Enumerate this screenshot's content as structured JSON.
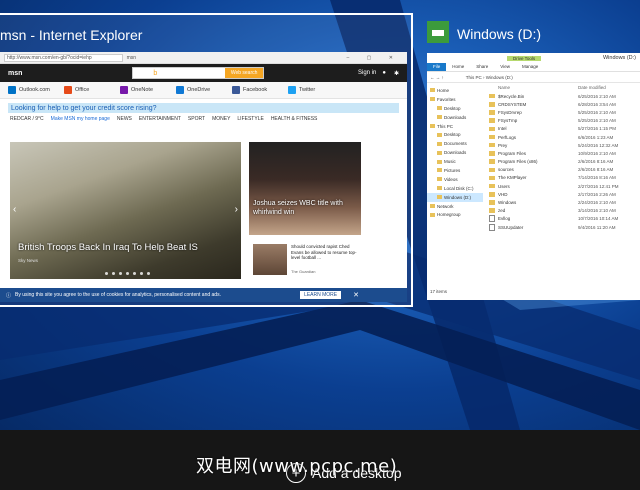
{
  "ie_window": {
    "title": "msn - Internet Explorer",
    "address_url": "http://www.msn.com/en-gb/?ocid=iehp",
    "address_tab": "msn",
    "msn": {
      "logo": "msn",
      "search_button": "Web search",
      "sign_in": "Sign in",
      "apps": [
        "Outlook.com",
        "Office",
        "OneNote",
        "OneDrive",
        "Facebook",
        "Twitter"
      ],
      "ad_text": "Looking for help to get your credit score rising?",
      "location": "REDCAR / 9°C",
      "make_home": "Make MSN my home page",
      "nav": [
        "NEWS",
        "ENTERTAINMENT",
        "SPORT",
        "MONEY",
        "LIFESTYLE",
        "HEALTH & FITNESS"
      ],
      "hero_caption": "British Troops Back In Iraq To Help Beat IS",
      "hero_source": "Sky News",
      "side_caption": "Joshua seizes WBC title with whirlwind win",
      "story_text": "Should convicted rapist Ched Evans be allowed to resume top-level football ...",
      "story_source": "The Guardian",
      "cookie_text": "By using this site you agree to the use of cookies for analytics, personalised content and ads.",
      "learn_more": "LEARN MORE",
      "close": "✕"
    }
  },
  "explorer_window": {
    "title": "Windows (D:)",
    "titlebar_tab": "Drive Tools",
    "titlebar_title": "Windows (D:)",
    "ribbon_tabs": [
      "File",
      "Home",
      "Share",
      "View",
      "Manage"
    ],
    "address_path": "This PC › Windows (D:)",
    "column_name": "Name",
    "column_date": "Date modified",
    "nav": [
      {
        "label": "Home",
        "selected": false
      },
      {
        "label": "Favorites",
        "selected": false
      },
      {
        "label": "Desktop",
        "selected": false
      },
      {
        "label": "Downloads",
        "selected": false
      },
      {
        "label": "This PC",
        "selected": false
      },
      {
        "label": "Desktop",
        "selected": false
      },
      {
        "label": "Documents",
        "selected": false
      },
      {
        "label": "Downloads",
        "selected": false
      },
      {
        "label": "Music",
        "selected": false
      },
      {
        "label": "Pictures",
        "selected": false
      },
      {
        "label": "Videos",
        "selected": false
      },
      {
        "label": "Local Disk (C:)",
        "selected": false
      },
      {
        "label": "Windows (D:)",
        "selected": true
      },
      {
        "label": "Network",
        "selected": false
      },
      {
        "label": "Homegroup",
        "selected": false
      }
    ],
    "files": [
      {
        "name": "$Recycle.Bin",
        "date": "6/25/2016 2:10 AM",
        "folder": true
      },
      {
        "name": "CRDSYSTEM",
        "date": "6/28/2016 3:54 AM",
        "folder": true
      },
      {
        "name": "FSysDrvrep",
        "date": "5/25/2016 2:10 AM",
        "folder": true
      },
      {
        "name": "FSysTmp",
        "date": "5/25/2016 2:10 AM",
        "folder": true
      },
      {
        "name": "Intel",
        "date": "5/27/2016 1:15 PM",
        "folder": true
      },
      {
        "name": "PerfLogs",
        "date": "6/6/2016 1:23 AM",
        "folder": true
      },
      {
        "name": "Prey",
        "date": "5/24/2016 12:32 AM",
        "folder": true
      },
      {
        "name": "Program Files",
        "date": "10/9/2016 2:10 AM",
        "folder": true
      },
      {
        "name": "Program Files (x86)",
        "date": "2/6/2016 8:16 AM",
        "folder": true
      },
      {
        "name": "sources",
        "date": "2/6/2016 8:16 AM",
        "folder": true
      },
      {
        "name": "The KMPlayer",
        "date": "7/14/2016 8:16 AM",
        "folder": true
      },
      {
        "name": "Users",
        "date": "2/27/2016 12:41 PM",
        "folder": true
      },
      {
        "name": "VHD",
        "date": "2/17/2016 2:26 AM",
        "folder": true
      },
      {
        "name": "Windows",
        "date": "2/24/2016 2:10 AM",
        "folder": true
      },
      {
        "name": "zed",
        "date": "3/14/2016 2:10 AM",
        "folder": true
      },
      {
        "name": "Evllog",
        "date": "10/7/2016 10:14 AM",
        "folder": false
      },
      {
        "name": "SSUUpdater",
        "date": "9/4/2016 11:20 AM",
        "folder": false
      }
    ],
    "status": "17 items"
  },
  "add_desktop": {
    "label": "Add a desktop",
    "icon": "plus-icon"
  },
  "watermark": "双电网(www.pcpc.me)"
}
